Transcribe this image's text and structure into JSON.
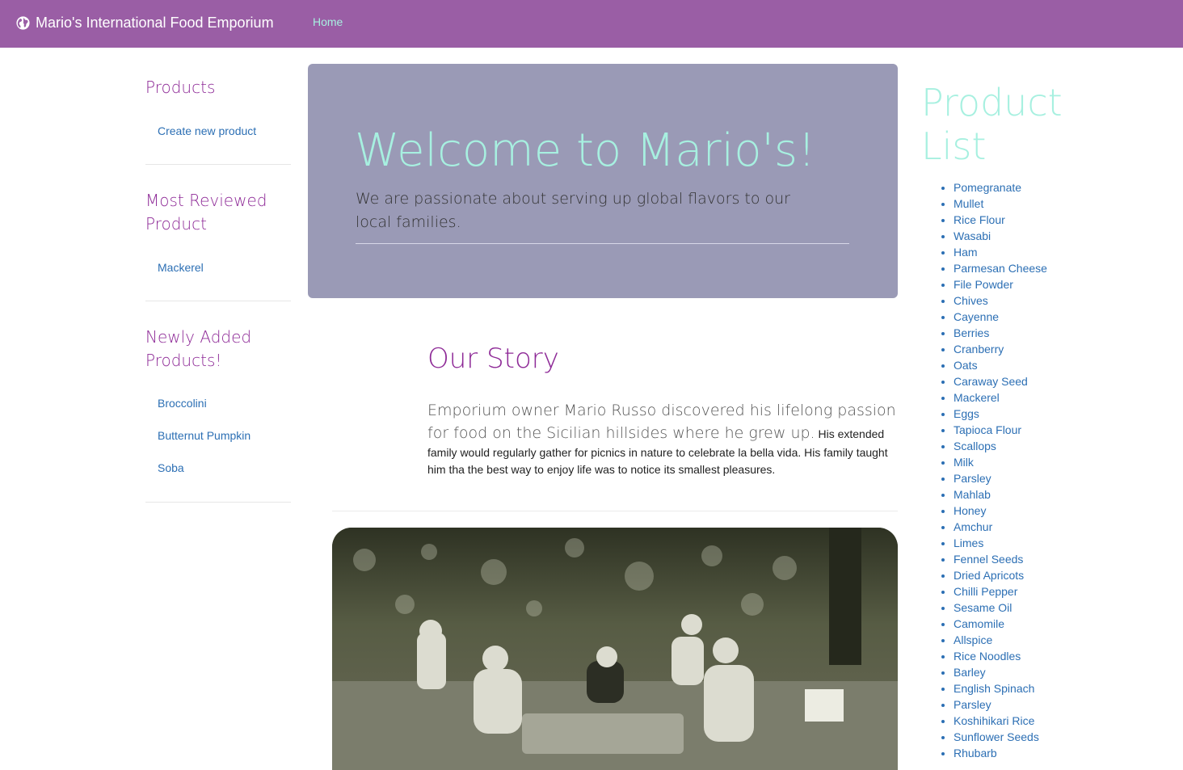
{
  "navbar": {
    "brand": "Mario's International Food Emporium",
    "brand_icon": "globe-icon",
    "home": "Home",
    "background": "#9a5ea5"
  },
  "sidebar": {
    "products_title": "Products",
    "products_links": [
      "Create new product"
    ],
    "most_reviewed_title": "Most Reviewed Product",
    "most_reviewed_links": [
      "Mackerel"
    ],
    "newly_added_title": "Newly Added Products!",
    "newly_added_links": [
      "Broccolini",
      "Butternut Pumpkin",
      "Soba"
    ]
  },
  "jumbotron": {
    "title": "Welcome to Mario's!",
    "subtitle": "We are passionate about serving up global flavors to our local families."
  },
  "story": {
    "title": "Our Story",
    "lead": "Emporium owner Mario Russo discovered his lifelong passion for food on the Sicilian hillsides where he grew up.",
    "body": "His extended family would regularly gather for picnics in nature to celebrate la bella vida. His family taught him tha the best way to enjoy life was to notice its smallest pleasures."
  },
  "product_list": {
    "title": "Product List",
    "items": [
      "Pomegranate",
      "Mullet",
      "Rice Flour",
      "Wasabi",
      "Ham",
      "Parmesan Cheese",
      "File Powder",
      "Chives",
      "Cayenne",
      "Berries",
      "Cranberry",
      "Oats",
      "Caraway Seed",
      "Mackerel",
      "Eggs",
      "Tapioca Flour",
      "Scallops",
      "Milk",
      "Parsley",
      "Mahlab",
      "Honey",
      "Amchur",
      "Limes",
      "Fennel Seeds",
      "Dried Apricots",
      "Chilli Pepper",
      "Sesame Oil",
      "Camomile",
      "Allspice",
      "Rice Noodles",
      "Barley",
      "English Spinach",
      "Parsley",
      "Koshihikari Rice",
      "Sunflower Seeds",
      "Rhubarb"
    ]
  },
  "colors": {
    "accent_purple": "#8e2a97",
    "mint": "#a7f0e0",
    "link_blue": "#2c6fb4",
    "jumbotron_bg": "#9a9ab6"
  }
}
